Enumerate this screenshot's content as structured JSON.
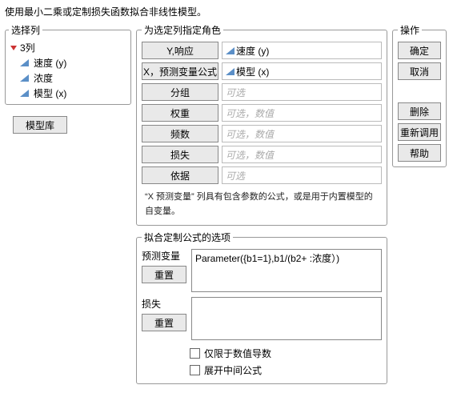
{
  "topText": "使用最小二乘或定制损失函数拟合非线性模型。",
  "selectCols": {
    "legend": "选择列",
    "root": "3列",
    "items": [
      "速度 (y)",
      "浓度",
      "模型 (x)"
    ]
  },
  "modelLib": "模型库",
  "roles": {
    "legend": "为选定列指定角色",
    "rows": [
      {
        "btn": "Y,响应",
        "val": "速度 (y)",
        "hasIcon": true,
        "opt": false
      },
      {
        "btn": "X，预测变量公式",
        "val": "模型 (x)",
        "hasIcon": true,
        "opt": false
      },
      {
        "btn": "分组",
        "val": "可选",
        "hasIcon": false,
        "opt": true
      },
      {
        "btn": "权重",
        "val": "可选，数值",
        "hasIcon": false,
        "opt": true
      },
      {
        "btn": "频数",
        "val": "可选，数值",
        "hasIcon": false,
        "opt": true
      },
      {
        "btn": "损失",
        "val": "可选，数值",
        "hasIcon": false,
        "opt": true
      },
      {
        "btn": "依据",
        "val": "可选",
        "hasIcon": false,
        "opt": true
      }
    ],
    "note": "“X 预测变量” 列具有包含参数的公式，或是用于内置模型的自变量。"
  },
  "fit": {
    "legend": "拟合定制公式的选项",
    "predLabel": "预测变量",
    "predReset": "重置",
    "predValue": "Parameter({b1=1},b1/(b2+ :浓度）)",
    "lossLabel": "损失",
    "lossReset": "重置",
    "lossValue": "",
    "chk1": "仅限于数值导数",
    "chk2": "展开中间公式"
  },
  "actions": {
    "legend": "操作",
    "ok": "确定",
    "cancel": "取消",
    "remove": "删除",
    "recall": "重新调用",
    "help": "帮助"
  }
}
